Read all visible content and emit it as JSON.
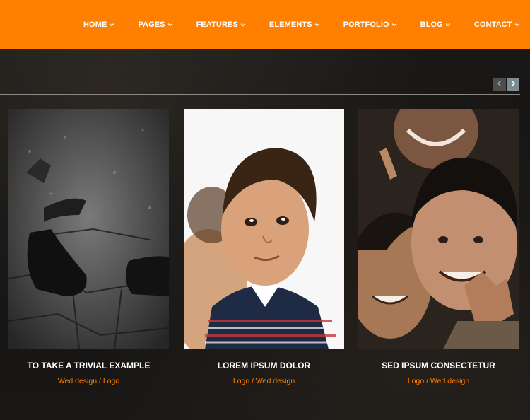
{
  "colors": {
    "accent": "#ff7f00",
    "title_text": "#ffffff",
    "meta_text": "#ff7f00"
  },
  "nav": {
    "items": [
      {
        "label": "HOME",
        "icon": "chevron-down-icon"
      },
      {
        "label": "PAGES",
        "icon": "chevron-down-icon"
      },
      {
        "label": "FEATURES",
        "icon": "chevron-down-icon"
      },
      {
        "label": "ELEMENTS",
        "icon": "chevron-down-icon"
      },
      {
        "label": "PORTFOLIO",
        "icon": "chevron-down-icon"
      },
      {
        "label": "BLOG",
        "icon": "chevron-down-icon"
      },
      {
        "label": "CONTACT",
        "icon": "chevron-down-icon"
      }
    ]
  },
  "carousel": {
    "prev_icon": "chevron-left-icon",
    "next_icon": "chevron-right-icon"
  },
  "portfolio": {
    "items": [
      {
        "title": "TO TAKE A TRIVIAL EXAMPLE",
        "meta": "Wed design / Logo",
        "image": "black-and-white-boots-on-cobblestones"
      },
      {
        "title": "LOREM IPSUM DOLOR",
        "meta": "Logo / Wed design",
        "image": "boy-looking-up"
      },
      {
        "title": "SED IPSUM CONSECTETUR",
        "meta": "Logo / Wed design",
        "image": "smiling-children-group"
      }
    ]
  }
}
